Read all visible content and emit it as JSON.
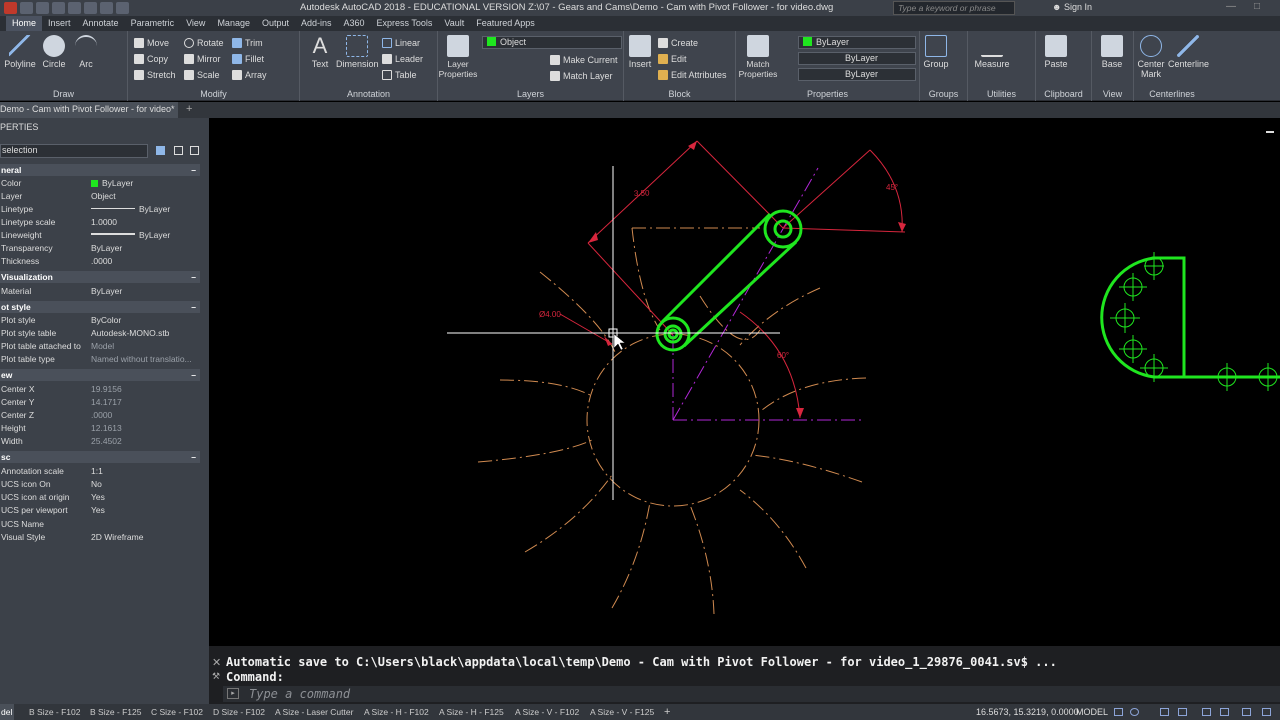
{
  "window": {
    "title": "Autodesk AutoCAD 2018 - EDUCATIONAL VERSION    Z:\\07 - Gears and Cams\\Demo - Cam with Pivot Follower - for video.dwg",
    "search_placeholder": "Type a keyword or phrase",
    "sign_in": "Sign In"
  },
  "ribbon_tabs": [
    "Home",
    "Insert",
    "Annotate",
    "Parametric",
    "View",
    "Manage",
    "Output",
    "Add-ins",
    "A360",
    "Express Tools",
    "Vault",
    "Featured Apps"
  ],
  "ribbon": {
    "draw": {
      "title": "Draw",
      "polyline": "Polyline",
      "circle": "Circle",
      "arc": "Arc"
    },
    "modify": {
      "title": "Modify",
      "move": "Move",
      "rotate": "Rotate",
      "trim": "Trim",
      "copy": "Copy",
      "mirror": "Mirror",
      "fillet": "Fillet",
      "stretch": "Stretch",
      "scale": "Scale",
      "array": "Array"
    },
    "annotation": {
      "title": "Annotation",
      "text": "Text",
      "dimension": "Dimension",
      "linear": "Linear",
      "leader": "Leader",
      "table": "Table"
    },
    "layers": {
      "title": "Layers",
      "layer_properties": "Layer Properties",
      "current_layer": "Object",
      "make_current": "Make Current",
      "match_layer": "Match Layer"
    },
    "block": {
      "title": "Block",
      "insert": "Insert",
      "create": "Create",
      "edit": "Edit",
      "edit_attributes": "Edit Attributes"
    },
    "properties": {
      "title": "Properties",
      "match_properties": "Match Properties",
      "color": "ByLayer",
      "linetype": "ByLayer",
      "lineweight": "ByLayer"
    },
    "groups": {
      "title": "Groups",
      "group": "Group"
    },
    "utilities": {
      "title": "Utilities",
      "measure": "Measure"
    },
    "clipboard": {
      "title": "Clipboard",
      "paste": "Paste"
    },
    "view": {
      "title": "View",
      "base": "Base"
    },
    "centerlines": {
      "title": "Centerlines",
      "center_mark": "Center Mark",
      "centerline": "Centerline"
    }
  },
  "doc_tab": "Demo - Cam with Pivot Follower - for video*",
  "properties_palette": {
    "title": "PERTIES",
    "selection": "selection",
    "sections": {
      "general": "neral",
      "visualization": "Visualization",
      "plot_style": "ot style",
      "view": "ew",
      "misc": "sc"
    },
    "general": [
      {
        "name": "Color",
        "value": "ByLayer"
      },
      {
        "name": "Layer",
        "value": "Object"
      },
      {
        "name": "Linetype",
        "value": "ByLayer"
      },
      {
        "name": "Linetype scale",
        "value": "1.0000"
      },
      {
        "name": "Lineweight",
        "value": "ByLayer"
      },
      {
        "name": "Transparency",
        "value": "ByLayer"
      },
      {
        "name": "Thickness",
        "value": ".0000"
      }
    ],
    "visualization": [
      {
        "name": "Material",
        "value": "ByLayer"
      }
    ],
    "plot_style": [
      {
        "name": "Plot style",
        "value": "ByColor"
      },
      {
        "name": "Plot style table",
        "value": "Autodesk-MONO.stb"
      },
      {
        "name": "Plot table attached to",
        "value": "Model"
      },
      {
        "name": "Plot table type",
        "value": "Named without translatio..."
      }
    ],
    "view": [
      {
        "name": "Center X",
        "value": "19.9156"
      },
      {
        "name": "Center Y",
        "value": "14.1717"
      },
      {
        "name": "Center Z",
        "value": ".0000"
      },
      {
        "name": "Height",
        "value": "12.1613"
      },
      {
        "name": "Width",
        "value": "25.4502"
      }
    ],
    "misc": [
      {
        "name": "Annotation scale",
        "value": "1:1"
      },
      {
        "name": "UCS icon On",
        "value": "No"
      },
      {
        "name": "UCS icon at origin",
        "value": "Yes"
      },
      {
        "name": "UCS per viewport",
        "value": "Yes"
      },
      {
        "name": "UCS Name",
        "value": ""
      },
      {
        "name": "Visual Style",
        "value": "2D Wireframe"
      }
    ]
  },
  "drawing": {
    "dim_350": "3.50",
    "dim_45": "45°",
    "dim_60": "60°",
    "dim_dia": "Ø4.00",
    "colors": {
      "object": "#1fe61f",
      "dimension": "#d7263d",
      "centerline": "#d08a50",
      "magenta": "#b027d6",
      "crosshair": "#ffffff"
    }
  },
  "command": {
    "history_1": "Automatic save to C:\\Users\\black\\appdata\\local\\temp\\Demo - Cam with Pivot Follower - for video_1_29876_0041.sv$ ...",
    "history_2": "Command:",
    "placeholder": "Type a command"
  },
  "layout_tabs": [
    "Model",
    "B Size - F102",
    "B Size - F125",
    "C Size - F102",
    "D Size - F102",
    "A Size - Laser Cutter",
    "A Size - H - F102",
    "A Size - H - F125",
    "A Size - V - F102",
    "A Size - V - F125"
  ],
  "status": {
    "coordinates": "16.5673, 15.3219, 0.0000",
    "model": "MODEL"
  }
}
